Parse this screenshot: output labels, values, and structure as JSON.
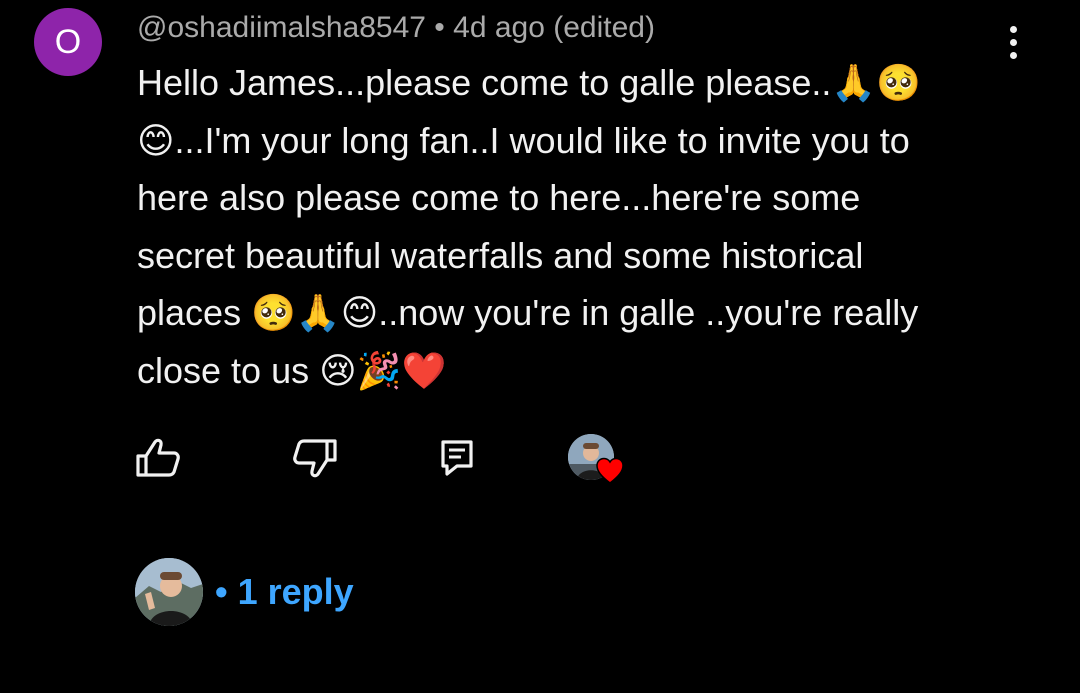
{
  "comment": {
    "avatar_letter": "O",
    "avatar_color": "#8e24aa",
    "meta": "@oshadiimalsha8547 • 4d ago (edited)",
    "text_lines": [
      "Hello James...please come to galle please..🙏🥺",
      "😊...I'm your long fan..I would like to invite you to",
      "here also  please come to here...here're some",
      "secret beautiful waterfalls and some historical",
      "places 🥺🙏😊..now you're in galle ..you're really",
      "close to us 😢🎉❤️"
    ]
  },
  "actions": {
    "like_icon": "thumb-up-outline-icon",
    "dislike_icon": "thumb-down-outline-icon",
    "reply_icon": "comment-reply-icon",
    "creator_heart_icon": "creator-heart-icon",
    "heart_color": "#ff0000"
  },
  "replies": {
    "label": "• 1 reply",
    "link_color": "#3ea6ff"
  },
  "theme": {
    "background": "#000000",
    "text_primary": "#f1f1f1",
    "text_secondary": "#aaaaaa"
  }
}
